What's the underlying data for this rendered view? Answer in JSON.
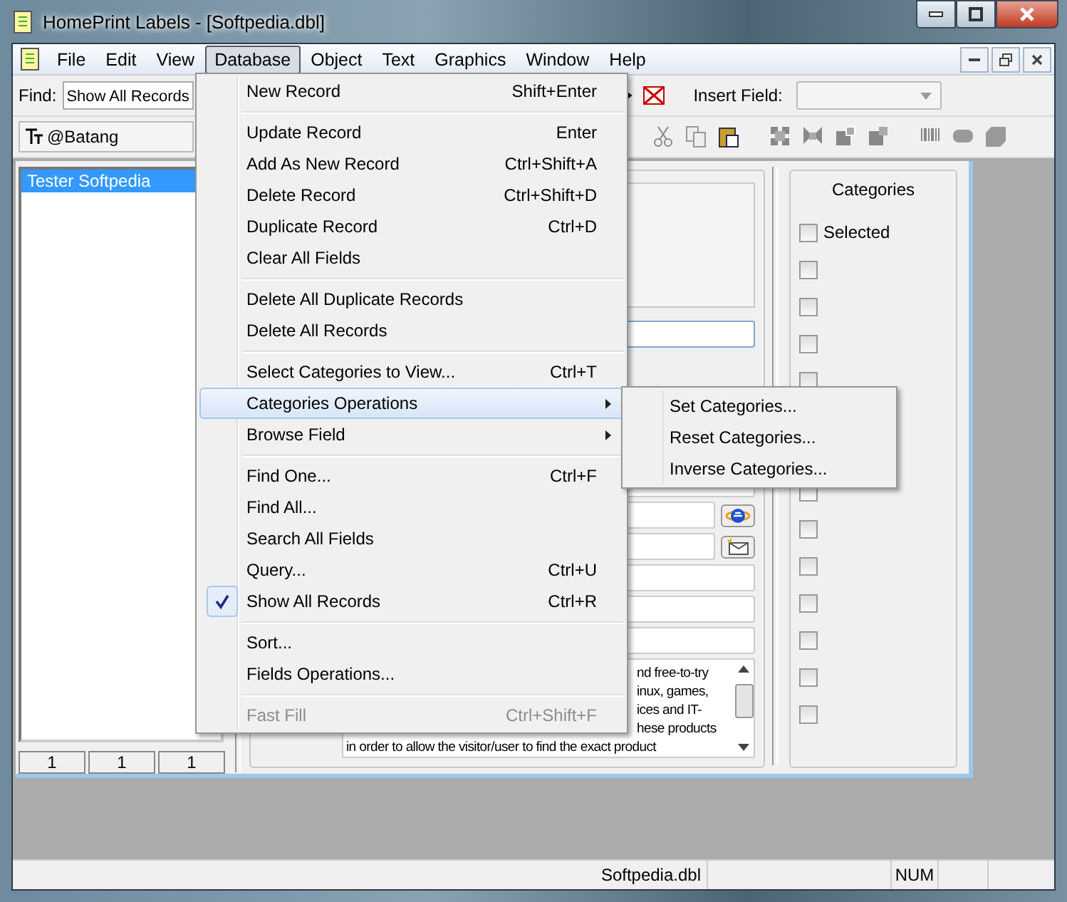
{
  "window": {
    "title": "HomePrint Labels - [Softpedia.dbl]"
  },
  "menu_bar": [
    {
      "label": "File",
      "selected": false
    },
    {
      "label": "Edit",
      "selected": false
    },
    {
      "label": "View",
      "selected": false
    },
    {
      "label": "Database",
      "selected": true
    },
    {
      "label": "Object",
      "selected": false
    },
    {
      "label": "Text",
      "selected": false
    },
    {
      "label": "Graphics",
      "selected": false
    },
    {
      "label": "Window",
      "selected": false
    },
    {
      "label": "Help",
      "selected": false
    }
  ],
  "toolbar": {
    "find_label": "Find:",
    "find_value": "Show All Records",
    "insert_field_label": "Insert Field:",
    "font": "@Batang"
  },
  "database_menu": [
    {
      "kind": "item",
      "label": "New Record",
      "shortcut": "Shift+Enter",
      "selected": false,
      "checked": false,
      "disabled": false,
      "submenu": false
    },
    {
      "kind": "separator"
    },
    {
      "kind": "item",
      "label": "Update Record",
      "shortcut": "Enter",
      "selected": false,
      "checked": false,
      "disabled": false,
      "submenu": false
    },
    {
      "kind": "item",
      "label": "Add As New Record",
      "shortcut": "Ctrl+Shift+A",
      "selected": false,
      "checked": false,
      "disabled": false,
      "submenu": false
    },
    {
      "kind": "item",
      "label": "Delete Record",
      "shortcut": "Ctrl+Shift+D",
      "selected": false,
      "checked": false,
      "disabled": false,
      "submenu": false
    },
    {
      "kind": "item",
      "label": "Duplicate Record",
      "shortcut": "Ctrl+D",
      "selected": false,
      "checked": false,
      "disabled": false,
      "submenu": false
    },
    {
      "kind": "item",
      "label": "Clear All Fields",
      "selected": false,
      "checked": false,
      "disabled": false,
      "submenu": false
    },
    {
      "kind": "separator"
    },
    {
      "kind": "item",
      "label": "Delete All Duplicate Records",
      "selected": false,
      "checked": false,
      "disabled": false,
      "submenu": false
    },
    {
      "kind": "item",
      "label": "Delete All Records",
      "selected": false,
      "checked": false,
      "disabled": false,
      "submenu": false
    },
    {
      "kind": "separator"
    },
    {
      "kind": "item",
      "label": "Select Categories to View...",
      "shortcut": "Ctrl+T",
      "selected": false,
      "checked": false,
      "disabled": false,
      "submenu": false
    },
    {
      "kind": "item",
      "label": "Categories Operations",
      "selected": true,
      "checked": false,
      "disabled": false,
      "submenu": true
    },
    {
      "kind": "item",
      "label": "Browse Field",
      "selected": false,
      "checked": false,
      "disabled": false,
      "submenu": true
    },
    {
      "kind": "separator"
    },
    {
      "kind": "item",
      "label": "Find One...",
      "shortcut": "Ctrl+F",
      "selected": false,
      "checked": false,
      "disabled": false,
      "submenu": false
    },
    {
      "kind": "item",
      "label": "Find All...",
      "selected": false,
      "checked": false,
      "disabled": false,
      "submenu": false
    },
    {
      "kind": "item",
      "label": "Search All Fields",
      "selected": false,
      "checked": false,
      "disabled": false,
      "submenu": false
    },
    {
      "kind": "item",
      "label": "Query...",
      "shortcut": "Ctrl+U",
      "selected": false,
      "checked": false,
      "disabled": false,
      "submenu": false
    },
    {
      "kind": "item",
      "label": "Show All Records",
      "shortcut": "Ctrl+R",
      "selected": false,
      "checked": true,
      "disabled": false,
      "submenu": false
    },
    {
      "kind": "separator"
    },
    {
      "kind": "item",
      "label": "Sort...",
      "selected": false,
      "checked": false,
      "disabled": false,
      "submenu": false
    },
    {
      "kind": "item",
      "label": "Fields Operations...",
      "selected": false,
      "checked": false,
      "disabled": false,
      "submenu": false
    },
    {
      "kind": "separator"
    },
    {
      "kind": "item",
      "label": "Fast Fill",
      "shortcut": "Ctrl+Shift+F",
      "selected": false,
      "checked": false,
      "disabled": true,
      "submenu": false
    }
  ],
  "categories_submenu": [
    {
      "label": "Set Categories..."
    },
    {
      "label": "Reset Categories..."
    },
    {
      "label": "Inverse Categories..."
    }
  ],
  "record_list": [
    {
      "label": "Tester Softpedia",
      "selected": true
    }
  ],
  "counters": [
    "1",
    "1",
    "1"
  ],
  "description_lines": [
    "nd free-to-try",
    "inux, games,",
    "ices and IT-",
    "hese products",
    "in order to allow the visitor/user to find the exact product"
  ],
  "categories": {
    "title": "Categories",
    "items": [
      {
        "label": "Selected",
        "checked": false
      },
      {
        "checked": false
      },
      {
        "checked": false
      },
      {
        "checked": false
      },
      {
        "checked": false
      },
      {
        "checked": false
      },
      {
        "checked": false
      },
      {
        "checked": false
      },
      {
        "checked": false
      },
      {
        "checked": false
      },
      {
        "checked": false
      },
      {
        "checked": false
      }
    ]
  },
  "status_bar": {
    "file": "Softpedia.dbl",
    "num": "NUM"
  }
}
